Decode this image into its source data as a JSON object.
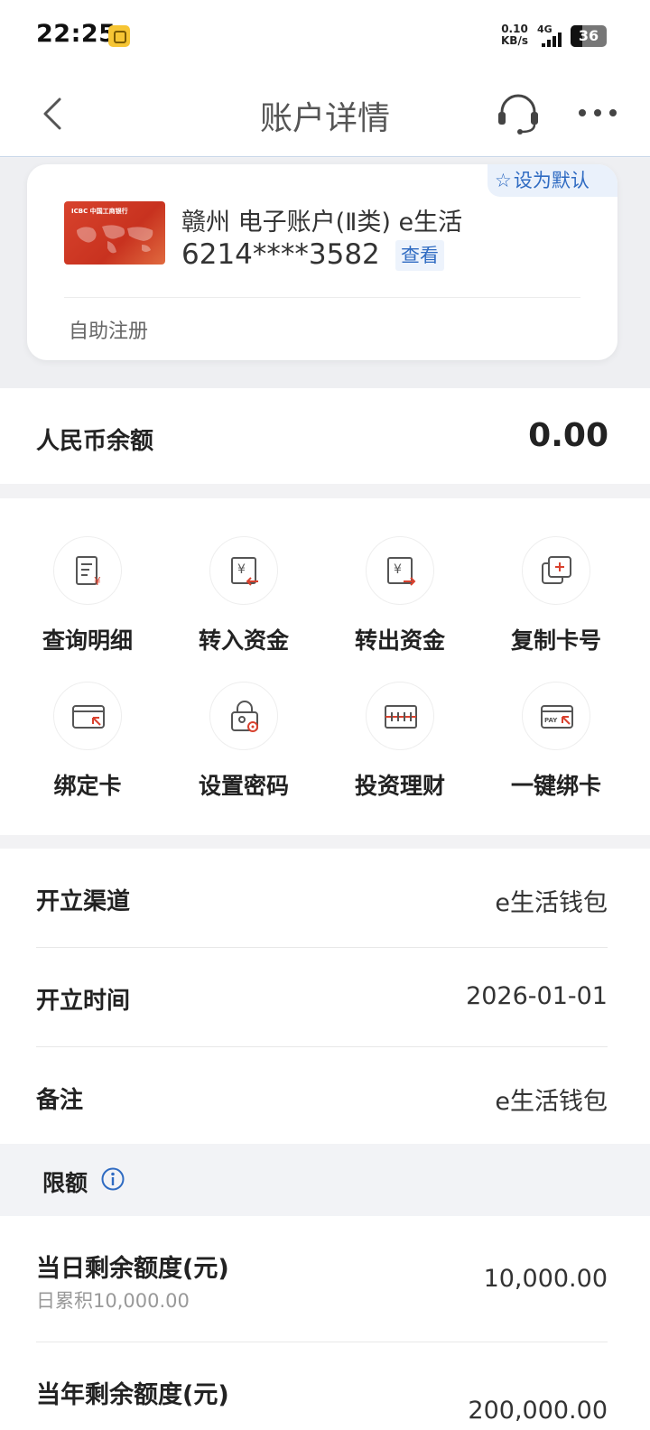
{
  "status_bar": {
    "time": "22:25",
    "net_speed_value": "0.10",
    "net_speed_unit": "KB/s",
    "network": "4G",
    "battery": "36"
  },
  "nav": {
    "title": "账户详情"
  },
  "card": {
    "default_label": "设为默认",
    "account_name": "赣州 电子账户(Ⅱ类) e生活",
    "account_number": "6214****3582",
    "view_label": "查看",
    "register_label": "自助注册",
    "card_logo_text": "ICBC 中国工商银行"
  },
  "balance": {
    "label": "人民币余额",
    "value": "0.00"
  },
  "actions": [
    {
      "label": "查询明细",
      "icon": "receipt-yen-icon"
    },
    {
      "label": "转入资金",
      "icon": "transfer-in-icon"
    },
    {
      "label": "转出资金",
      "icon": "transfer-out-icon"
    },
    {
      "label": "复制卡号",
      "icon": "copy-icon"
    },
    {
      "label": "绑定卡",
      "icon": "bind-card-icon"
    },
    {
      "label": "设置密码",
      "icon": "lock-settings-icon"
    },
    {
      "label": "投资理财",
      "icon": "invest-icon"
    },
    {
      "label": "一键绑卡",
      "icon": "pay-card-icon"
    }
  ],
  "info": {
    "channel_label": "开立渠道",
    "channel_value": "e生活钱包",
    "date_label": "开立时间",
    "date_value": "2026-01-01",
    "note_label": "备注",
    "note_value": "e生活钱包"
  },
  "limits": {
    "header": "限额",
    "daily_label": "当日剩余额度(元)",
    "daily_sub": "日累积10,000.00",
    "daily_value": "10,000.00",
    "yearly_label": "当年剩余额度(元)",
    "yearly_value": "200,000.00"
  },
  "colors": {
    "accent": "#2f6bc2",
    "icon_red": "#d9412e",
    "card_red": "#d8432d"
  }
}
